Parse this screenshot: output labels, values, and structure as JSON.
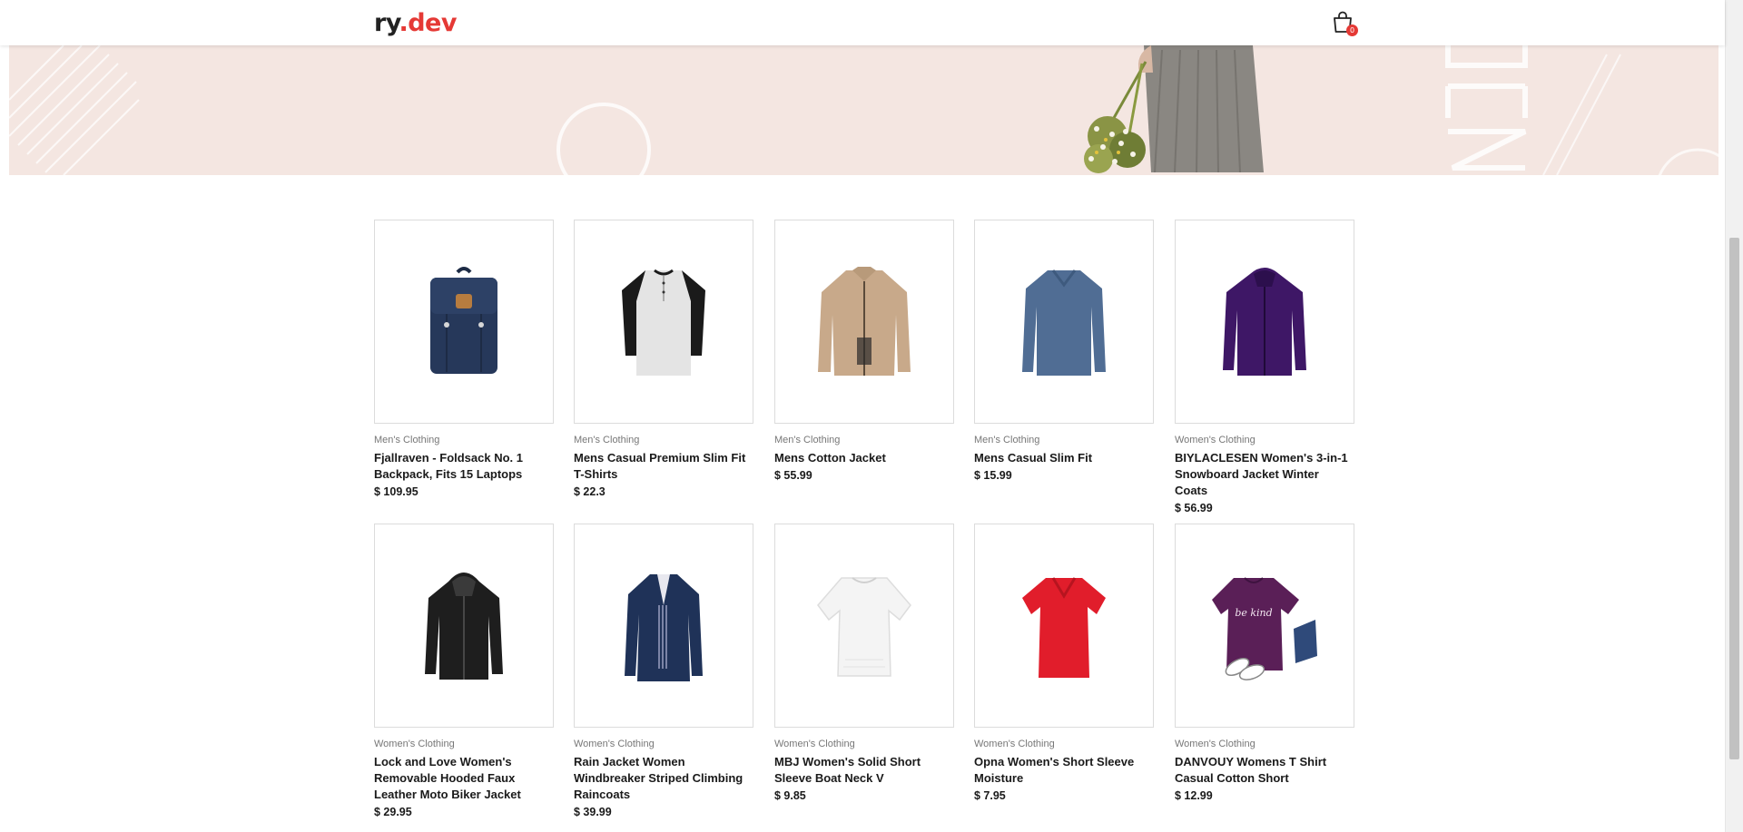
{
  "header": {
    "logo_main": "ry",
    "logo_dot": ".",
    "logo_accent": "dev",
    "cart_icon": "shopping-bag-icon",
    "cart_count": "0"
  },
  "colors": {
    "accent": "#e53935",
    "hero_bg": "#f4e6e1",
    "border": "#dcdcdc"
  },
  "products": [
    {
      "category": "Men's Clothing",
      "title": "Fjallraven - Foldsack No. 1 Backpack, Fits 15 Laptops",
      "price": "$ 109.95",
      "image": "navy-backpack"
    },
    {
      "category": "Men's Clothing",
      "title": "Mens Casual Premium Slim Fit T-Shirts",
      "price": "$ 22.3",
      "image": "raglan-henley-shirt"
    },
    {
      "category": "Men's Clothing",
      "title": "Mens Cotton Jacket",
      "price": "$ 55.99",
      "image": "khaki-jacket"
    },
    {
      "category": "Men's Clothing",
      "title": "Mens Casual Slim Fit",
      "price": "$ 15.99",
      "image": "blue-long-sleeve-shirt"
    },
    {
      "category": "Women's Clothing",
      "title": "BIYLACLESEN Women's 3-in-1 Snowboard Jacket Winter Coats",
      "price": "$ 56.99",
      "image": "purple-snow-jacket"
    },
    {
      "category": "Women's Clothing",
      "title": "Lock and Love Women's Removable Hooded Faux Leather Moto Biker Jacket",
      "price": "$ 29.95",
      "image": "black-leather-jacket"
    },
    {
      "category": "Women's Clothing",
      "title": "Rain Jacket Women Windbreaker Striped Climbing Raincoats",
      "price": "$ 39.99",
      "image": "navy-raincoat"
    },
    {
      "category": "Women's Clothing",
      "title": "MBJ Women's Solid Short Sleeve Boat Neck V",
      "price": "$ 9.85",
      "image": "white-top"
    },
    {
      "category": "Women's Clothing",
      "title": "Opna Women's Short Sleeve Moisture",
      "price": "$ 7.95",
      "image": "red-tee"
    },
    {
      "category": "Women's Clothing",
      "title": "DANVOUY Womens T Shirt Casual Cotton Short",
      "price": "$ 12.99",
      "image": "purple-tee-be-kind"
    }
  ],
  "tee_print": "be kind"
}
